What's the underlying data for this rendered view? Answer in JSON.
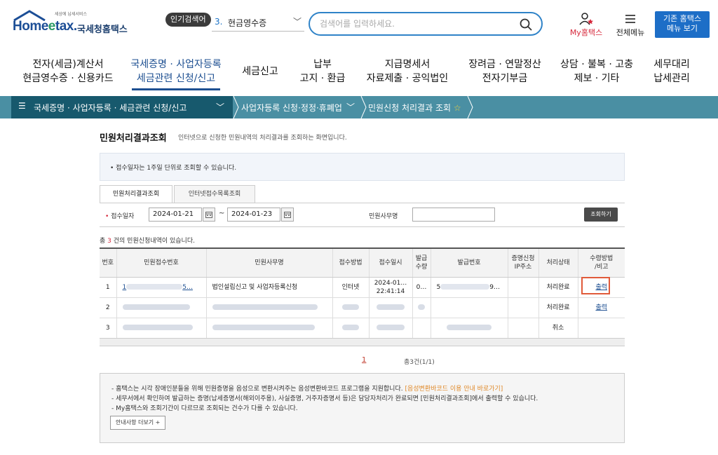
{
  "header": {
    "logo_small": "세상에 납세서비스",
    "logo_home": "Home",
    "logo_e": "e",
    "logo_tax": "tax.",
    "logo_kor": "국세청홈택스",
    "popular_badge": "인기검색어",
    "popular_rank": "3.",
    "popular_term": "현금영수증",
    "search_placeholder": "검색어를 입력하세요.",
    "my_home": "My홈택스",
    "all_menu": "전체메뉴",
    "old_home_line1": "기존 홈택스",
    "old_home_line2": "메뉴 보기"
  },
  "gnb": [
    {
      "line1": "전자(세금)계산서",
      "line2": "현금영수증 · 신용카드"
    },
    {
      "line1": "국세증명 · 사업자등록",
      "line2": "세금관련 신청/신고"
    },
    {
      "line1": "세금신고",
      "line2": ""
    },
    {
      "line1": "납부",
      "line2": "고지 · 환급"
    },
    {
      "line1": "지급명세서",
      "line2": "자료제출 · 공익법인"
    },
    {
      "line1": "장려금 · 연말정산",
      "line2": "전자기부금"
    },
    {
      "line1": "상담 · 불복 · 고충",
      "line2": "제보 · 기타"
    },
    {
      "line1": "세무대리",
      "line2": "납세관리"
    }
  ],
  "breadcrumb": {
    "level1": "국세증명 · 사업자등록 · 세금관련 신청/신고",
    "level2": "사업자등록 신청·정정·휴폐업",
    "level3": "민원신청 처리결과 조회",
    "star": "☆"
  },
  "page": {
    "title": "민원처리결과조회",
    "description": "인터넷으로 신청한 민원내역의 처리결과를 조회하는 화면입니다.",
    "notice": "• 접수일자는 1주일 단위로 조회할 수 있습니다."
  },
  "tabs": [
    {
      "label": "민원처리결과조회",
      "active": true
    },
    {
      "label": "인터넷접수목록조회",
      "active": false
    }
  ],
  "filter": {
    "date_label": "접수일자",
    "required_mark": "•",
    "date_from": "2024-01-21",
    "date_to": "2024-01-23",
    "tilde": "~",
    "office_label": "민원사무명",
    "office_value": "",
    "search_button": "조회하기"
  },
  "result_count": {
    "prefix": "총 ",
    "count": "3",
    "suffix": " 건의 민원신청내역이 있습니다."
  },
  "table": {
    "headers": [
      {
        "l1": "번호",
        "l2": ""
      },
      {
        "l1": "민원접수번호",
        "l2": ""
      },
      {
        "l1": "민원사무명",
        "l2": ""
      },
      {
        "l1": "접수방법",
        "l2": ""
      },
      {
        "l1": "접수일시",
        "l2": ""
      },
      {
        "l1": "발급",
        "l2": "수량"
      },
      {
        "l1": "발급번호",
        "l2": ""
      },
      {
        "l1": "증명신청",
        "l2": "IP주소"
      },
      {
        "l1": "처리상태",
        "l2": ""
      },
      {
        "l1": "수령방법",
        "l2": "/비고"
      }
    ],
    "rows": [
      {
        "no": "1",
        "receipt_no_start": "1",
        "receipt_no_end": "5…",
        "office": "법인설립신고 및 사업자등록신청",
        "method": "인터넷",
        "date_l1": "2024-01…",
        "date_l2": "22:41:14",
        "qty": "0…",
        "issue_no_start": "5",
        "issue_no_end": "9…",
        "status": "처리완료",
        "action": "출력"
      },
      {
        "no": "2",
        "status": "처리완료",
        "action": "출력"
      },
      {
        "no": "3",
        "status": "취소",
        "action": ""
      }
    ]
  },
  "pager": {
    "current": "1",
    "total": "총3건(1/1)"
  },
  "guide": {
    "line1": "- 홈택스는 시각 장애인분들을 위해 민원증명을 음성으로 변환시켜주는 음성변환바코드 프로그램을 지원합니다.",
    "line1_link": "[음성변환바코드 이용 안내 바로가기]",
    "line2": "- 세무서에서 확인하여 발급하는 증명(납세증명서(해외이주용), 사실증명, 거주자증명서 등)은 담당자처리가 완료되면 [민원처리결과조회]에서 출력할 수 있습니다.",
    "line3": "- My홈택스와 조회기간이 다르므로 조회되는 건수가 다를 수 있습니다.",
    "more_button": "안내사항 더보기 +"
  },
  "colors": {
    "brand_blue": "#1d4f91",
    "breadcrumb_dark": "#17596d",
    "breadcrumb_light": "#4a8fa3",
    "accent_red": "#d6283b",
    "highlight_box": "#e05a3a"
  }
}
